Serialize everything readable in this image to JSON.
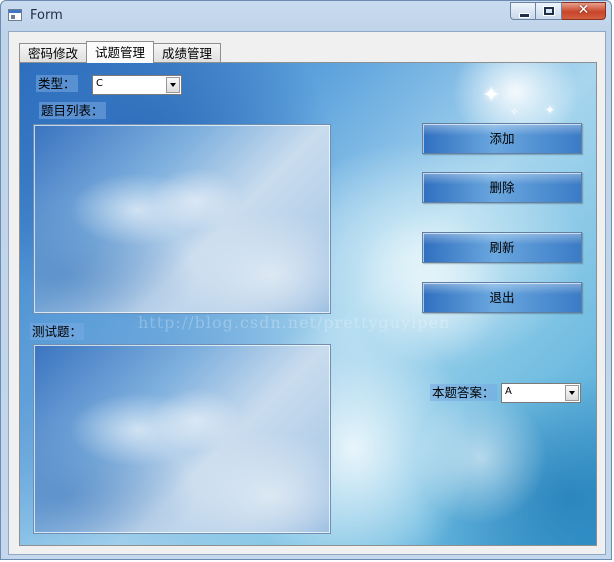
{
  "window": {
    "title": "Form",
    "buttons": {
      "minimize": "minimize",
      "maximize": "maximize",
      "close": "✕"
    }
  },
  "tabs": [
    {
      "label": "密码修改",
      "active": false
    },
    {
      "label": "试题管理",
      "active": true
    },
    {
      "label": "成绩管理",
      "active": false
    }
  ],
  "form": {
    "type_label": "类型：",
    "type_value": "C",
    "question_list_label": "题目列表：",
    "test_question_label": "测试题：",
    "answer_label": "本题答案：",
    "answer_value": "A"
  },
  "actions": {
    "add": "添加",
    "delete": "删除",
    "refresh": "刷新",
    "exit": "退出"
  },
  "watermark": "http://blog.csdn.net/prettyguyipen",
  "colors": {
    "title_bar": "#c9dbef",
    "close_button": "#c8452a",
    "button_blue": "#3b7bc6"
  }
}
